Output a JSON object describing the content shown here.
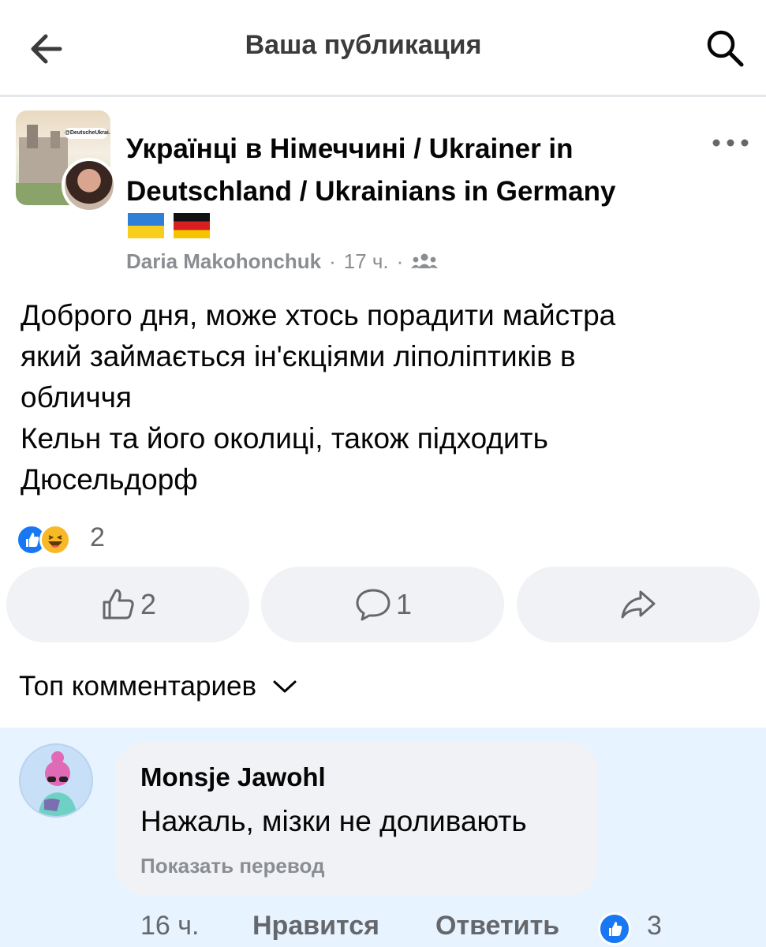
{
  "header": {
    "title": "Ваша публикация",
    "back_icon": "arrow-left-icon",
    "search_icon": "search-icon"
  },
  "post": {
    "group_name": "Українці в Німеччині / Ukrainer in Deutschland / Ukrainians in Germany",
    "group_cover_badge": "@DeutscheUkrai..",
    "flags": [
      "flag-ukraine",
      "flag-germany"
    ],
    "author": "Daria Makohonchuk",
    "time": "17 ч.",
    "separator": "·",
    "audience_icon": "group-members-icon",
    "more_icon": "more-dots-icon",
    "text": "Доброго дня,  може хтось порадити майстра\nякий займається ін'єкціями ліполіптиків в\nобличчя\nКельн та його околиці, також підходить\nДюсельдорф",
    "reactions": {
      "types": [
        "like",
        "haha"
      ],
      "count": "2"
    },
    "actions": {
      "like_count": "2",
      "comment_count": "1",
      "share_icon": "share-arrow-icon"
    }
  },
  "comments": {
    "sort_label": "Топ комментариев",
    "items": [
      {
        "author": "Monsje Jawohl",
        "text": "Нажаль, мізки не доливають",
        "show_translation": "Показать перевод",
        "time": "16 ч.",
        "like_label": "Нравится",
        "reply_label": "Ответить",
        "reaction_count": "3"
      }
    ]
  },
  "colors": {
    "accent": "#1877f2",
    "muted": "#65676b",
    "highlight": "#e7f3ff",
    "button_bg": "#f0f2f5"
  }
}
